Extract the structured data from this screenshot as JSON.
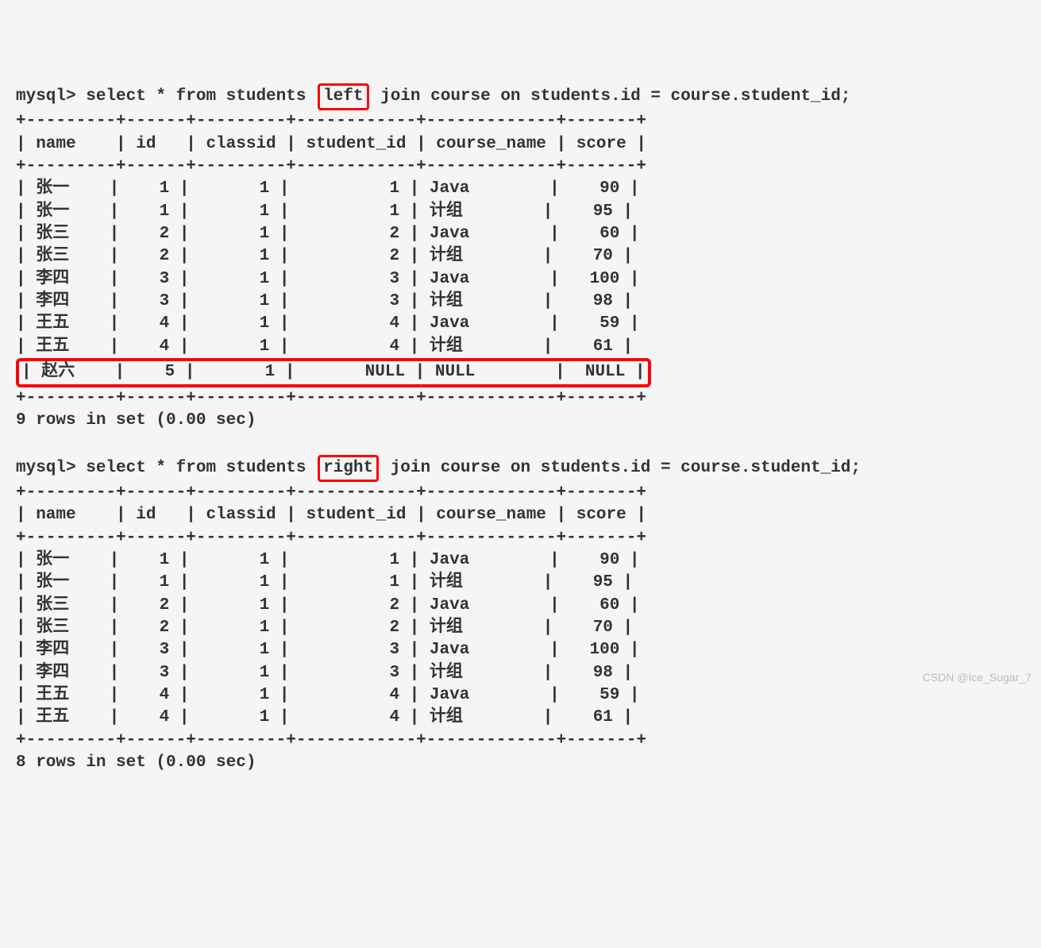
{
  "query1": {
    "prompt": "mysql> ",
    "prefix": "select * from students ",
    "keyword": "left",
    "suffix": " join course on students.id = course.student_id;",
    "border_top": "+---------+------+---------+------------+-------------+-------+",
    "border_header": "+---------+------+---------+------------+-------------+-------+",
    "border_row": "+---------+------+---------+------------+-------------+-------+",
    "header": "| name    | id   | classid | student_id | course_name | score |",
    "rows": [
      "| 张一    |    1 |       1 |          1 | Java        |    90 |",
      "| 张一    |    1 |       1 |          1 | 计组        |    95 |",
      "| 张三    |    2 |       1 |          2 | Java        |    60 |",
      "| 张三    |    2 |       1 |          2 | 计组        |    70 |",
      "| 李四    |    3 |       1 |          3 | Java        |   100 |",
      "| 李四    |    3 |       1 |          3 | 计组        |    98 |",
      "| 王五    |    4 |       1 |          4 | Java        |    59 |",
      "| 王五    |    4 |       1 |          4 | 计组        |    61 |"
    ],
    "highlight_row": "| 赵六    |    5 |       1 |       NULL | NULL        |  NULL |",
    "footer": "9 rows in set (0.00 sec)"
  },
  "query2": {
    "prompt": "mysql> ",
    "prefix": "select * from students ",
    "keyword": "right",
    "suffix": " join course on students.id = course.student_id;",
    "border_top": "+---------+------+---------+------------+-------------+-------+",
    "border_header": "+---------+------+---------+------------+-------------+-------+",
    "border_row": "+---------+------+---------+------------+-------------+-------+",
    "header": "| name    | id   | classid | student_id | course_name | score |",
    "rows": [
      "| 张一    |    1 |       1 |          1 | Java        |    90 |",
      "| 张一    |    1 |       1 |          1 | 计组        |    95 |",
      "| 张三    |    2 |       1 |          2 | Java        |    60 |",
      "| 张三    |    2 |       1 |          2 | 计组        |    70 |",
      "| 李四    |    3 |       1 |          3 | Java        |   100 |",
      "| 李四    |    3 |       1 |          3 | 计组        |    98 |",
      "| 王五    |    4 |       1 |          4 | Java        |    59 |",
      "| 王五    |    4 |       1 |          4 | 计组        |    61 |"
    ],
    "footer": "8 rows in set (0.00 sec)"
  },
  "watermark": "CSDN @Ice_Sugar_7"
}
